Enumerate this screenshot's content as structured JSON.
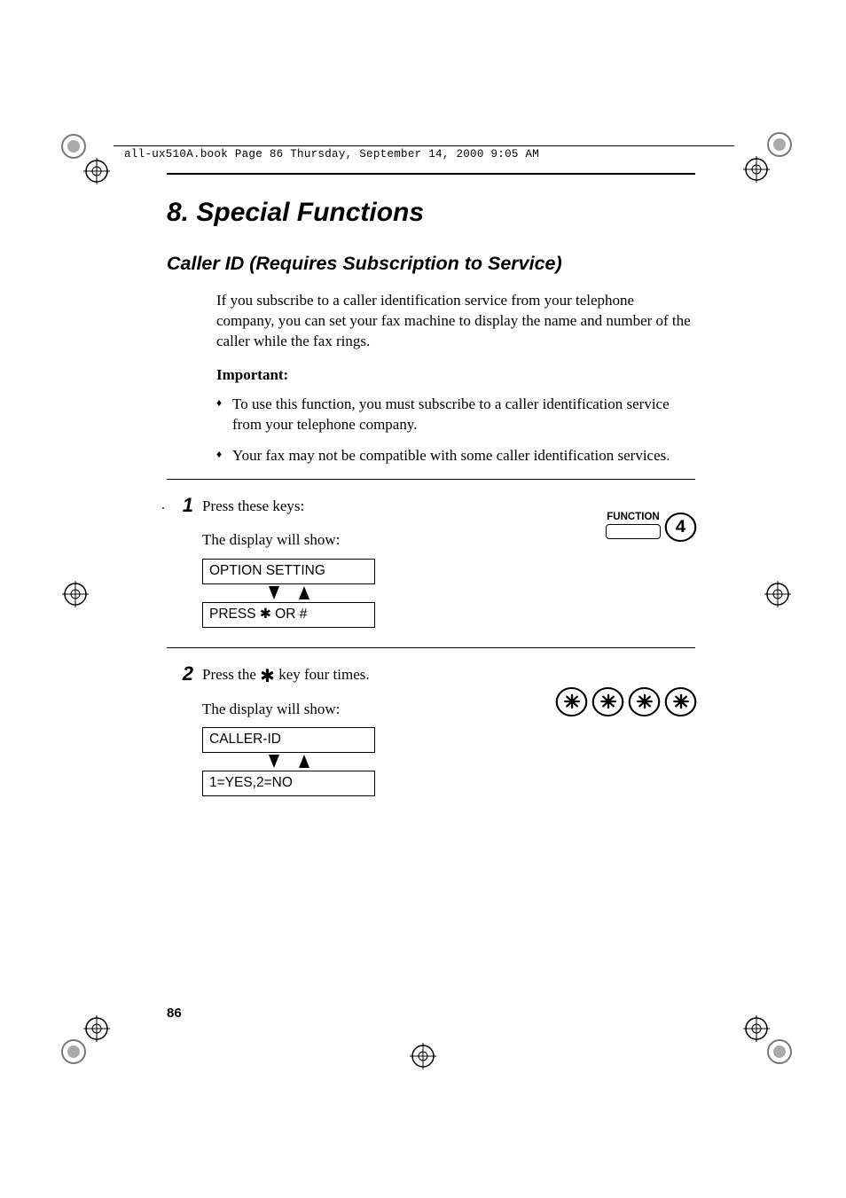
{
  "header_line": "all-ux510A.book  Page 86  Thursday, September 14, 2000  9:05 AM",
  "chapter_title": "8.  Special Functions",
  "section_title": "Caller ID (Requires Subscription to Service)",
  "intro_para": "If you subscribe to a caller identification service from your telephone company, you can set your fax machine to display the name and number of the caller while the fax rings.",
  "important_label": "Important:",
  "bullets": [
    "To use this function, you must subscribe to a caller identification service from your telephone company.",
    "Your fax may not be compatible with some caller identification services."
  ],
  "steps": {
    "s1": {
      "num": "1",
      "dot": ".",
      "text": "Press these keys:",
      "sub": "The display will show:",
      "lcd_top": "OPTION SETTING",
      "lcd_bottom": "PRESS ✱ OR #",
      "func_label": "FUNCTION",
      "key_digit": "4"
    },
    "s2": {
      "num": "2",
      "text_a": "Press the ",
      "text_b": " key four times.",
      "star": "✱",
      "sub": "The display will show:",
      "lcd_top": "CALLER-ID",
      "lcd_bottom": "1=YES,2=NO"
    }
  },
  "page_number": "86"
}
